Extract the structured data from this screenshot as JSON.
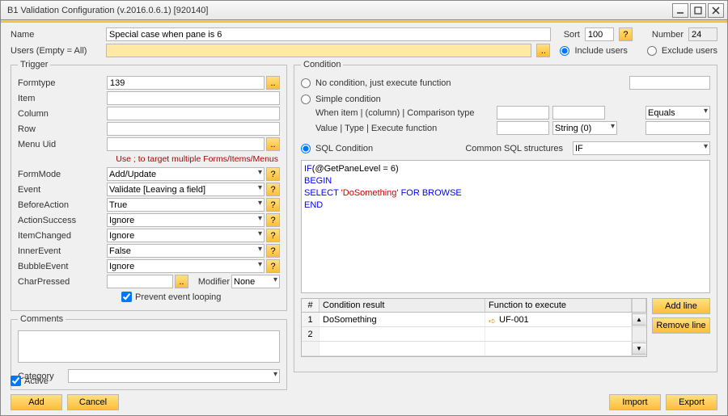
{
  "title": "B1 Validation Configuration (v.2016.0.6.1) [920140]",
  "header": {
    "name_label": "Name",
    "name_value": "Special case when pane is 6",
    "sort_label": "Sort",
    "sort_value": "100",
    "number_label": "Number",
    "number_value": "24",
    "users_label": "Users (Empty = All)",
    "users_value": "",
    "include_users": "Include users",
    "exclude_users": "Exclude users"
  },
  "trigger": {
    "legend": "Trigger",
    "formtype_label": "Formtype",
    "formtype_value": "139",
    "item_label": "Item",
    "item_value": "",
    "column_label": "Column",
    "column_value": "",
    "row_label": "Row",
    "row_value": "",
    "menuuid_label": "Menu Uid",
    "menuuid_value": "",
    "hint": "Use ; to target multiple Forms/Items/Menus",
    "formmode_label": "FormMode",
    "formmode_value": "Add/Update",
    "event_label": "Event",
    "event_value": "Validate [Leaving a field]",
    "beforeaction_label": "BeforeAction",
    "beforeaction_value": "True",
    "actionsuccess_label": "ActionSuccess",
    "actionsuccess_value": "Ignore",
    "itemchanged_label": "ItemChanged",
    "itemchanged_value": "Ignore",
    "innerevent_label": "InnerEvent",
    "innerevent_value": "False",
    "bubbleevent_label": "BubbleEvent",
    "bubbleevent_value": "Ignore",
    "charpressed_label": "CharPressed",
    "charpressed_value": "",
    "modifier_label": "Modifier",
    "modifier_value": "None",
    "prevent_loop": "Prevent event looping"
  },
  "comments": {
    "legend": "Comments",
    "text": "",
    "category_label": "Category",
    "category_value": ""
  },
  "condition": {
    "legend": "Condition",
    "no_condition": "No condition, just execute function",
    "no_condition_input": "",
    "simple": "Simple condition",
    "simple_row1": "When item | (column) | Comparison type",
    "simple_row2": "Value | Type | Execute function",
    "simple_cmp": "Equals",
    "simple_type": "String (0)",
    "sql_label": "SQL Condition",
    "common_label": "Common SQL structures",
    "common_value": "IF",
    "sql_lines": [
      {
        "parts": [
          {
            "cls": "kw",
            "t": "IF"
          },
          {
            "cls": "txt",
            "t": "(@GetPaneLevel = 6)"
          }
        ]
      },
      {
        "parts": [
          {
            "cls": "kw",
            "t": "BEGIN"
          }
        ]
      },
      {
        "parts": [
          {
            "cls": "kw",
            "t": "SELECT "
          },
          {
            "cls": "str",
            "t": "'DoSomething'"
          },
          {
            "cls": "kw",
            "t": " FOR BROWSE"
          }
        ]
      },
      {
        "parts": [
          {
            "cls": "kw",
            "t": "END"
          }
        ]
      }
    ],
    "grid": {
      "h_idx": "#",
      "h_cr": "Condition result",
      "h_fn": "Function to execute",
      "rows": [
        {
          "idx": "1",
          "cr": "DoSomething",
          "fn": "UF-001"
        },
        {
          "idx": "2",
          "cr": "",
          "fn": ""
        }
      ]
    },
    "add_line": "Add line",
    "remove_line": "Remove line"
  },
  "footer": {
    "active": "Active",
    "add": "Add",
    "cancel": "Cancel",
    "import": "Import",
    "export": "Export"
  },
  "help_tip": "?",
  "cfl": "..",
  "minimize": "__",
  "maximize": "☐",
  "close": "✕"
}
